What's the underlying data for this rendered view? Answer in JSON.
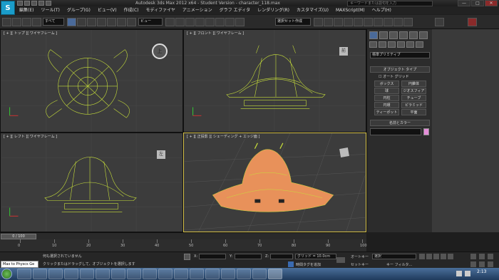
{
  "window": {
    "title": "Autodesk 3ds Max  2012 x64 - Student Version - character_118.max",
    "search_placeholder": "キーワードまたは語句を入力",
    "minimize": "—",
    "maximize": "□",
    "close": "✕"
  },
  "app_logo": "S",
  "menu": [
    "編集(E)",
    "ツール(T)",
    "グループ(G)",
    "ビュー(V)",
    "作成(C)",
    "モディファイヤ",
    "アニメーション",
    "グラフ エディタ",
    "レンダリング(R)",
    "カスタマイズ(U)",
    "MAXScript(M)",
    "ヘルプ(H)"
  ],
  "toolbar": {
    "selection_filter": "すべて",
    "ref_coord": "ビュー",
    "named_selection": "選択セット作成"
  },
  "viewports": {
    "top": {
      "label": "[ + ][ トップ ][ ワイヤフレーム ]",
      "cube": "上"
    },
    "front": {
      "label": "[ + ][ フロント ][ ワイヤフレーム ]",
      "cube": "前"
    },
    "left": {
      "label": "[ + ][ レフト ][ ワイヤフレーム ]",
      "cube": "左"
    },
    "perspective": {
      "label": "[ + ][ 正投影 ][ シェーディング + エッジ面 ]"
    }
  },
  "command_panel": {
    "dropdown": "標準プリミティブ",
    "object_type_header": "オブジェクト タイプ",
    "autogrid": "オート グリッド",
    "buttons": [
      "ボックス",
      "円錐体",
      "球",
      "ジオスフィア",
      "円柱",
      "チューブ",
      "円環",
      "ピラミッド",
      "ティーポット",
      "平面"
    ],
    "name_color_header": "名前とカラー",
    "color_swatch": "#e58ed9"
  },
  "timeline": {
    "frame": "0 / 100",
    "ticks": [
      "0",
      "10",
      "20",
      "30",
      "40",
      "50",
      "60",
      "70",
      "80",
      "90",
      "100"
    ]
  },
  "status": {
    "maxscript": "Max to Physcs Ge",
    "selection": "何も選択されていません",
    "prompt": "クリックまたはドラッグして、オブジェクトを選択します",
    "x_label": "X:",
    "y_label": "Y:",
    "z_label": "Z:",
    "grid": "グリッド = 10.0cm",
    "time_tag": "時間タグを追加",
    "autokey": "オートキー",
    "selected": "選択",
    "setkey": "セットキー",
    "keyfilter": "キー フィルタ..."
  },
  "taskbar": {
    "clock": "2:13"
  },
  "colors": {
    "accent": "#d7c24a",
    "wire": "#c8e03a",
    "shaded": "#e8915a"
  }
}
